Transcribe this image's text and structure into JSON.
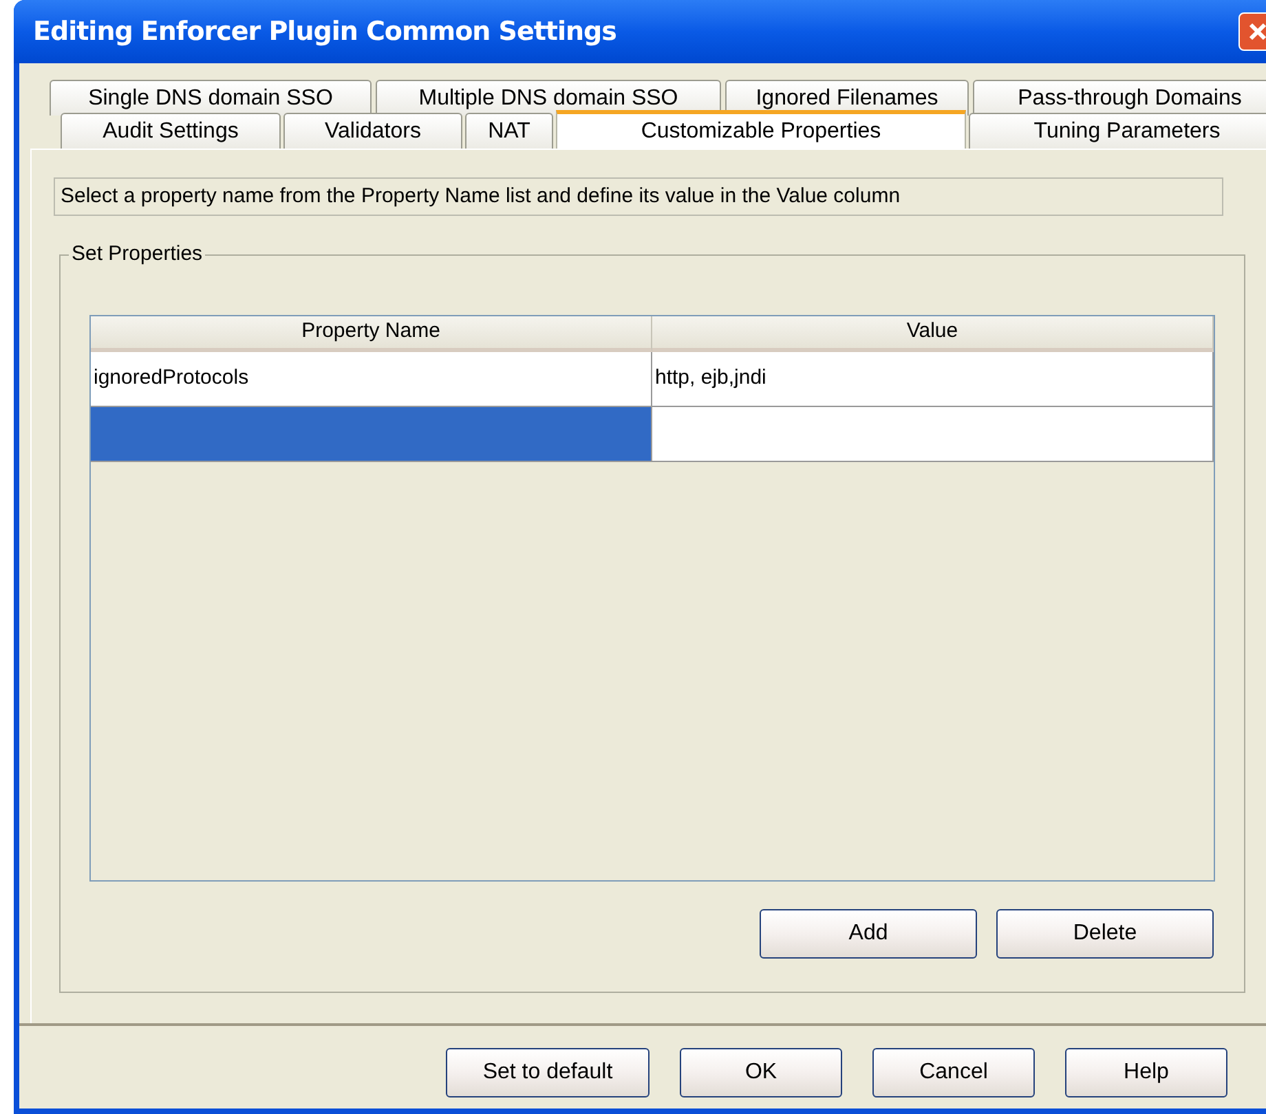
{
  "window": {
    "title": "Editing Enforcer Plugin Common Settings"
  },
  "tab_rows": [
    [
      {
        "label": "Single DNS domain SSO",
        "selected": false
      },
      {
        "label": "Multiple DNS domain SSO",
        "selected": false
      },
      {
        "label": "Ignored Filenames",
        "selected": false
      },
      {
        "label": "Pass-through Domains",
        "selected": false
      }
    ],
    [
      {
        "label": "Audit Settings",
        "selected": false
      },
      {
        "label": "Validators",
        "selected": false
      },
      {
        "label": "NAT",
        "selected": false
      },
      {
        "label": "Customizable Properties",
        "selected": true
      },
      {
        "label": "Tuning Parameters",
        "selected": false
      }
    ]
  ],
  "description": "Select a property name from the Property Name list and define its value in the Value column",
  "group": {
    "title": "Set Properties",
    "table": {
      "columns": [
        "Property Name",
        "Value"
      ],
      "rows": [
        {
          "cells": [
            "ignoredProtocols",
            "http, ejb,jndi"
          ],
          "selected": false
        },
        {
          "cells": [
            "",
            ""
          ],
          "selected": true
        }
      ]
    },
    "buttons": [
      "Add",
      "Delete"
    ]
  },
  "buttons": [
    "Set to default",
    "OK",
    "Cancel",
    "Help"
  ]
}
